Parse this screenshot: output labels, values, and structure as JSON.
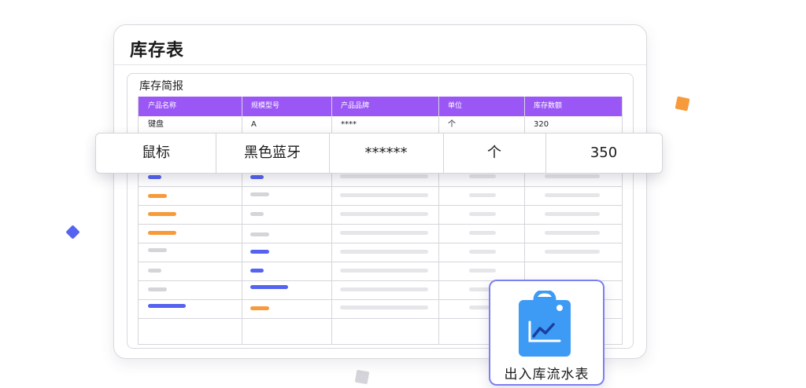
{
  "card": {
    "title": "库存表"
  },
  "report": {
    "title": "库存简报",
    "headers": [
      "产品名称",
      "规模型号",
      "产品品牌",
      "单位",
      "库存数额"
    ],
    "first_row": [
      "键盘",
      "A",
      "****",
      "个",
      "320"
    ],
    "highlight_row": [
      "鼠标",
      "黑色蓝牙",
      "******",
      "个",
      "350"
    ]
  },
  "flow_card": {
    "label": "出入库流水表",
    "icon": "clipboard-chart-icon"
  },
  "colors": {
    "header_purple": "#9b57f5",
    "accent_blue": "#5563f0",
    "accent_orange": "#f79a3b",
    "placeholder_gray": "#d4d4d9",
    "flow_icon_blue": "#3d9bf5"
  }
}
